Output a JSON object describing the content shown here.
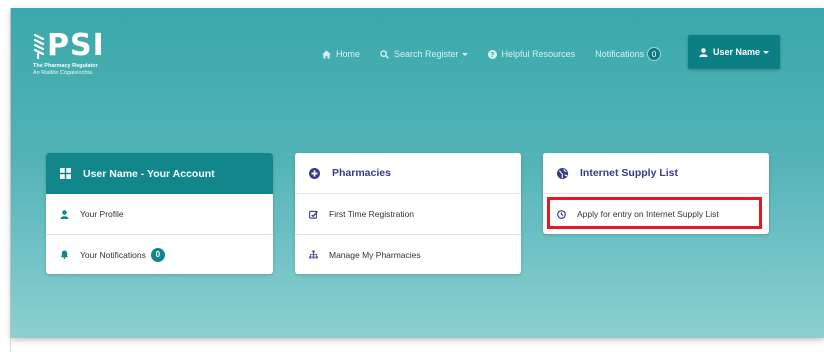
{
  "logo": {
    "text": "PSI",
    "line1": "The Pharmacy Regulator",
    "line2": "An Rialtóir Cógaisíochta",
    "icon": "psi-logo-mark"
  },
  "nav": {
    "home": "Home",
    "search": "Search Register",
    "resources": "Helpful Resources",
    "notifications": "Notifications",
    "notifications_count": "0",
    "user": "User Name"
  },
  "cards": {
    "account": {
      "title": "User Name - Your Account",
      "profile": "Your Profile",
      "notifications": "Your Notifications",
      "notifications_count": "0"
    },
    "pharmacies": {
      "title": "Pharmacies",
      "first_time": "First Time Registration",
      "manage": "Manage My Pharmacies"
    },
    "internet": {
      "title": "Internet Supply List",
      "apply": "Apply for entry on Internet Supply List"
    }
  },
  "colors": {
    "teal": "#11878b",
    "accent_text": "#3a3a8c",
    "highlight": "#e01b24"
  }
}
